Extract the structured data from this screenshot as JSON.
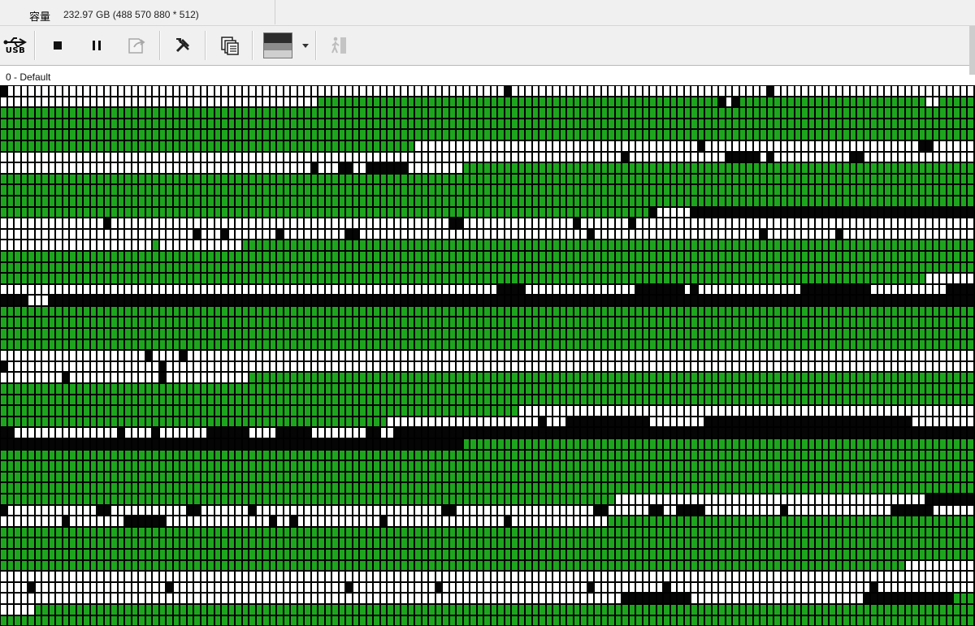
{
  "capacity": {
    "label": "容量",
    "value": "232.97 GB (488 570 880 * 512)"
  },
  "toolbar": {
    "usb_label": "USB",
    "buttons": [
      "usb-icon",
      "stop-icon",
      "pause-icon",
      "export-icon",
      "tools-icon",
      "copy-icon",
      "thumbnail-icon",
      "walk-icon"
    ]
  },
  "profile": {
    "label": "0 - Default"
  },
  "block_map": {
    "columns": 141,
    "legend_colors": {
      "good": "#1ea51e",
      "unread": "#ffffff",
      "bad": "#050505"
    },
    "rows": [
      "BWWWWWWWWWWWWWWWWWWWWWWWWWWWWWWWWWWWWWWWWWWWWWWWWWWWWWWWWWWWWWWWWWWWWWWWWBWWWWWWWWWWWWWWWWWWWWWWWWWWWWWWWWWWWWWBWWWWWWWWWWWWWWWWWWWWWWWWWWWWWW",
      "WWWWWWWWWWWWWWWWWWWWWWWWWWWWWWWWWWWWWWWWWWWWWWGGGGGGGGGGGGGGGGGGGGGGGGGGGGGGGGGGGGGGGGGGGGGGGGGGGGGGGGGGBWBGGGGGGGGGGGGGGGGGGGGGGGGGGGWWGGGGGGGGGGG",
      "GGGGGGGGGGGGGGGGGGGGGGGGGGGGGGGGGGGGGGGGGGGGGGGGGGGGGGGGGGGGGGGGGGGGGGGGGGGGGGGGGGGGGGGGGGGGGGGGGGGGGGGGGGGGGGGGGGGGGGGGGGGGGGGGGGGGGGGGGGGGGGGG",
      "GGGGGGGGGGGGGGGGGGGGGGGGGGGGGGGGGGGGGGGGGGGGGGGGGGGGGGGGGGGGGGGGGGGGGGGGGGGGGGGGGGGGGGGGGGGGGGGGGGGGGGGGGGGGGGGGGGGGGGGGGGGGGGGGGGGGGGGGGGGGGGG",
      "GGGGGGGGGGGGGGGGGGGGGGGGGGGGGGGGGGGGGGGGGGGGGGGGGGGGGGGGGGGGGGGGGGGGGGGGGGGGGGGGGGGGGGGGGGGGGGGGGGGGGGGGGGGGGGGGGGGGGGGGGGGGGGGGGGGGGGGGGGGGGGG",
      "GGGGGGGGGGGGGGGGGGGGGGGGGGGGGGGGGGGGGGGGGGGGGGGGGGGGGGGGGGGGWWWWWWWWWWWWWWWWWWWWWWWWWWWWWWWWWWWWWWWWWBWWWWWWWWWWWWWWWWWWWWWWWWWWWWWWWBBWWWWWWWWBW",
      "WWWWWWWWWWWWWWWWWWWWWWWWWWWWWWWWWWWWWWWWWWWWWWWWWWWWWWWWWWWWWWWWWWWWWWWWWWWWWWWWWWWWWWWWWWBWWWWWWWWWWWWWWBBBBBWBWWWWWWWWWWWBBWWWWWWWWWWWWWWWWWW",
      "WWWWWWWWWWWWWWWWWWWWWWWWWWWWWWWWWWWWWWWWWWWWWBWWWBBWWBBBBBBWWWWWWWWGGGGGGGGGGGGGGGGGGGGGGGGGGGGGGGGGGGGGGGGGGGGGGGGGGGGGGGGGGGGGGGGGGGGGGGGGGGGGG",
      "GGGGGGGGGGGGGGGGGGGGGGGGGGGGGGGGGGGGGGGGGGGGGGGGGGGGGGGGGGGGGGGGGGGGGGGGGGGGGGGGGGGGGGGGGGGGGGGGGGGGGGGGGGGGGGGGGGGGGGGGGGGGGGGGGGGGGGGGGGGGGGG",
      "GGGGGGGGGGGGGGGGGGGGGGGGGGGGGGGGGGGGGGGGGGGGGGGGGGGGGGGGGGGGGGGGGGGGGGGGGGGGGGGGGGGGGGGGGGGGGGGGGGGGGGGGGGGGGGGGGGGGGGGGGGGGGGGGGGGGGGGGGGGGGGG",
      "GGGGGGGGGGGGGGGGGGGGGGGGGGGGGGGGGGGGGGGGGGGGGGGGGGGGGGGGGGGGGGGGGGGGGGGGGGGGGGGGGGGGGGGGGGGGGGGGGGGGGGGGGGGGGGGGGGGGGGGGGGGGGGGGGGGGGGGGGGGGGGG",
      "GGGGGGGGGGGGGGGGGGGGGGGGGGGGGGGGGGGGGGGGGGGGGGGGGGGGGGGGGGGGGGGGGGGGGGGGGGGGGGGGGGGGGGGGGGGGGGBWWWWWBBBBBBBBBBBBBBBBBBBBBBBBBBBBBBBBBBBBBBBBBBBBB",
      "WWWWWWWWWWWWWWWBWWWWWWWWWWWWWWWWWWWWWWWWWWWWWWWWWWWWWWWWWWWWWWWWWBBWWWWWWWWWWWWWWWWBWWWWWWWBWWWWWWWWWWWWWWWWWWWWWWWWWWWWWWWWWWWWWWWWWWWWWWWWWWWWW",
      "WWWWWWWWWWWWWWWWWWWWWWWWWWWWBWWWBWWWWWWWBWWWWWWWWWBBWWWWWWWWWWWWWWWWWWWWWWWWWWWWWWWWWBWWWWWWWWWWWWWWWWWWWWWWWWBWWWWWWWWWWBWWWWWWWWWWWWWWWWWWWWWWWW",
      "WWWWWWWWWWWWWWWWWWWWWWGWWWWWWWWWWWWGGGGGGGGGGGGGGGGGGGGGGGGGGGGGGGGGGGGGGGGGGGGGGGGGGGGGGGGGGGGGGGGGGGGGGGGGGGGGGGGGGGGGGGGGGGGGGGGGGGGGGGGGGGGGG",
      "GGGGGGGGGGGGGGGGGGGGGGGGGGGGGGGGGGGGGGGGGGGGGGGGGGGGGGGGGGGGGGGGGGGGGGGGGGGGGGGGGGGGGGGGGGGGGGGGGGGGGGGGGGGGGGGGGGGGGGGGGGGGGGGGGGGGGGGGGGGGGGG",
      "GGGGGGGGGGGGGGGGGGGGGGGGGGGGGGGGGGGGGGGGGGGGGGGGGGGGGGGGGGGGGGGGGGGGGGGGGGGGGGGGGGGGGGGGGGGGGGGGGGGGGGGGGGGGGGGGGGGGGGGGGGGGGGGGGGGGGGGGGGGGGGG",
      "GGGGGGGGGGGGGGGGGGGGGGGGGGGGGGGGGGGGGGGGGGGGGGGGGGGGGGGGGGGGGGGGGGGGGGGGGGGGGGGGGGGGGGGGGGGGGGGGGGGGGGGGGGGGGGGGGGGGGGGGGGGGGGGGGGGGGGWWWWWWWWWWW",
      "WWWWWWWWWWWWWWWWWWWWWWWWWWWWWWWWWWWWWWWWWWWWWWWWWWWWWWWWWWWWWWWWWWWWWWWWBBBBWWWWWWWWWWWWWWWWBBBBBBBWBWWWWWWWWWWWWWWWBBBBBBBBBBWWWWWWWWWWWBBBBBBBBW",
      "BBBBWWWBBBBBBBBBBBBBBBBBBBBBBBBBBBBBBBBBBBBBBBBBBBBBBBBBBBBBBBBBBBBBBBBBBBBBBBBBBBBBBBBBBBBBBBBBBBBBBBBBBBBBBBBBBBBBBBBBBBBBBBBBBBBBBBBBBBBBBBBW",
      "GGGGGGGGGGGGGGGGGGGGGGGGGGGGGGGGGGGGGGGGGGGGGGGGGGGGGGGGGGGGGGGGGGGGGGGGGGGGGGGGGGGGGGGGGGGGGGGGGGGGGGGGGGGGGGGGGGGGGGGGGGGGGGGGGGGGGGGGGGGGGGG",
      "GGGGGGGGGGGGGGGGGGGGGGGGGGGGGGGGGGGGGGGGGGGGGGGGGGGGGGGGGGGGGGGGGGGGGGGGGGGGGGGGGGGGGGGGGGGGGGGGGGGGGGGGGGGGGGGGGGGGGGGGGGGGGGGGGGGGGGGGGGGGGGG",
      "GGGGGGGGGGGGGGGGGGGGGGGGGGGGGGGGGGGGGGGGGGGGGGGGGGGGGGGGGGGGGGGGGGGGGGGGGGGGGGGGGGGGGGGGGGGGGGGGGGGGGGGGGGGGGGGGGGGGGGGGGGGGGGGGGGGGGGGGGGGGGGG",
      "GGGGGGGGGGGGGGGGGGGGGGGGGGGGGGGGGGGGGGGGGGGGGGGGGGGGGGGGGGGGGGGGGGGGGGGGGGGGGGGGGGGGGGGGGGGGGGGGGGGGGGGGGGGGGGGGGGGGGGGGGGGGGGGGGGGGGGGGGGGGGGG",
      "WWWWWWWWWWWWWWWWWWWWWBWWWWBWWWWWWWWWWWWWWWWWWWWWWWWWWWWWWWWWWWWWWWWWWWWWWWWWWWWWWWWWWWWWWWWWWWWWWWWWWWWWWWWWWWWWWWWWWWWWWWWWWWWWWWWWWWWWWWWWWWWWW",
      "BWWWWWWWWWWWWWWWWWWWWWWBWWWWWWWWWWWWWWWWWWWWWWWWWWWWWWWWWWWWWWWWWWWWWWWWWWWWWWWWWWWWWWWWWWWWWWWWWWWWWWWWWWWWWWWWWWWWWWWWWWWWWWWWWWWWWWWWWWWWWWWWW",
      "WWWWWWWWWBWWWWWWWWWWWWWBWWWWWWWWWWWWGGGGGGGGGGGGGGGGGGGGGGGGGGGGGGGGGGGGGGGGGGGGGGGGGGGGGGGGGGGGGGGGGGGGGGGGGGGGGGGGGGGGGGGGGGGGGGGGGGGGGGGGGGGGGGG",
      "GGGGGGGGGGGGGGGGGGGGGGGGGGGGGGGGGGGGGGGGGGGGGGGGGGGGGGGGGGGGGGGGGGGGGGGGGGGGGGGGGGGGGGGGGGGGGGGGGGGGGGGGGGGGGGGGGGGGGGGGGGGGGGGGGGGGGGGGGGGGGG",
      "GGGGGGGGGGGGGGGGGGGGGGGGGGGGGGGGGGGGGGGGGGGGGGGGGGGGGGGGGGGGGGGGGGGGGGGGGGGGGGGGGGGGGGGGGGGGGGGGGGGGGGGGGGGGGGGGGGGGGGGGGGGGGGGGGGGGGGGGGGGGGGG",
      "GGGGGGGGGGGGGGGGGGGGGGGGGGGGGGGGGGGGGGGGGGGGGGGGGGGGGGGGGGGGGGGGGGGGGGGGGGGWWWWWWWWWWWWWWWWWWWWWWWWWWWWWWWWWWWWWWWWWWWWWWWWWWWWWWWWWWWWWWWWWWWW",
      "GGGGGGGGGGGGGGGGGGGGGGGGGGGGGGGGGGGGGGGGGGGGGGGGGGGGGGGGWWWWWWWWWWWWWWWWWWWWWWBWWWBBBBBBBBBBBBWWWWWWWWBBBBBBBBBBBBBBBBBBBBBBBBBBBBBBWWWWWWWWWWWWWW",
      "BBWWWWWWWWWWWWWWWBWWWWBWWWWWWWBBBBBBWWWWBBBBBWWWWWWWWBBWWBBBBBBBBBBBBBBBBBBBBBBBBBBBBBBBBBBBBBBBBBBBBBBBBBBBBBBBBBBBBBBBBBBBBBBBBBBBBBBBBBBBBBBBBB",
      "BBBBBBBBBBBBBBBBBBBBBBBBBBBBBBBBBBBBBBBBBBBBBBBBBBBBBBBBBBBBBBBBBBBGGGGGGGGGGGGGGGGGGGGGGGGGGGGGGGGGGGGGGGGGGGGGGGGGGGGGGGGGGGGGGGGGGGGGGGGGGGGGGG",
      "GGGGGGGGGGGGGGGGGGGGGGGGGGGGGGGGGGGGGGGGGGGGGGGGGGGGGGGGGGGGGGGGGGGGGGGGGGGGGGGGGGGGGGGGGGGGGGGGGGGGGGGGGGGGGGGGGGGGGGGGGGGGGGGGGGGGGGGGGGGGGGG",
      "GGGGGGGGGGGGGGGGGGGGGGGGGGGGGGGGGGGGGGGGGGGGGGGGGGGGGGGGGGGGGGGGGGGGGGGGGGGGGGGGGGGGGGGGGGGGGGGGGGGGGGGGGGGGGGGGGGGGGGGGGGGGGGGGGGGGGGGGGGGGGGG",
      "GGGGGGGGGGGGGGGGGGGGGGGGGGGGGGGGGGGGGGGGGGGGGGGGGGGGGGGGGGGGGGGGGGGGGGGGGGGGGGGGGGGGGGGGGGGGGGGGGGGGGGGGGGGGGGGGGGGGGGGGGGGGGGGGGGGGGGGGGGGGGGG",
      "GGGGGGGGGGGGGGGGGGGGGGGGGGGGGGGGGGGGGGGGGGGGGGGGGGGGGGGGGGGGGGGGGGGGGGGGGGGGGGGGGGGGGGGGGGGGGGGGGGGGGGGGGGGGGGGGGGGGGGGGGGGGGGGGGGGGGGGGGGGGGGG",
      "GGGGGGGGGGGGGGGGGGGGGGGGGGGGGGGGGGGGGGGGGGGGGGGGGGGGGGGGGGGGGGGGGGGGGGGGGGGGGGGGGGGGGGGGGWWWWWWWWWWWWWWWWWWWWWWWWWWWWWWWWWWWWWWWWWWWWWBBBBBBBWWWW",
      "BWWWWWWWWWWWWWBBWWWWWWWWWWWBBWWWWWWWBWWWWWWWWWWWWWWWWWWWWWWWWWWWBBWWWWWWWWWWWWWWWWWWWWBBWWWWWWBBWWBBBBWWWWWWWWWWWBWWWWWWWWWWWWWWWBBBBBBWWWWWWWWWWW",
      "WWWWWWWWWBWWWWWWWWBBBBBBWWWWWWWWWWWWWWWBWWBWWWWWWWWWWWWBWWWWWWWWWWWWWWWWWBWWWWWWWWWWWWWWGGGGGGGGGGGGGGGGGGGGGGGGGGGGGGGGGGGGGGGGGGGGGGGGGGGGGGGGGG",
      "GGGGGGGGGGGGGGGGGGGGGGGGGGGGGGGGGGGGGGGGGGGGGGGGGGGGGGGGGGGGGGGGGGGGGGGGGGGGGGGGGGGGGGGGGGGGGGGGGGGGGGGGGGGGGGGGGGGGGGGGGGGGGGGGGGGGGGGGGGGGGGGG",
      "GGGGGGGGGGGGGGGGGGGGGGGGGGGGGGGGGGGGGGGGGGGGGGGGGGGGGGGGGGGGGGGGGGGGGGGGGGGGGGGGGGGGGGGGGGGGGGGGGGGGGGGGGGGGGGGGGGGGGGGGGGGGGGGGGGGGGGGGGGGGGGG",
      "GGGGGGGGGGGGGGGGGGGGGGGGGGGGGGGGGGGGGGGGGGGGGGGGGGGGGGGGGGGGGGGGGGGGGGGGGGGGGGGGGGGGGGGGGGGGGGGGGGGGGGGGGGGGGGGGGGGGGGGGGGGGGGGGGGGGGGGGGGGGGGG",
      "GGGGGGGGGGGGGGGGGGGGGGGGGGGGGGGGGGGGGGGGGGGGGGGGGGGGGGGGGGGGGGGGGGGGGGGGGGGGGGGGGGGGGGGGGGGGGGGGGGGGGGGGGGGGGGGGGGGGGGGGGGGGGGGGGGGWWWWWWWWWWWWW",
      "WWWWWWWWWWWWWWWWWWWWWWWWWWWWWWWWWWWWWWWWWWWWWWWWWWWWWWWWWWWWWWWWWWWWWWWWWWWWWWWWWWWWWWWWWWWWWWWWWWWWWWWWWWWWWWWWWWWWWWWWWWWWWWWWWWWWWWWWWWWWWW",
      "WWWWBWWWWWWWWWWWWWWWWWWWBWWWWWWWWWWWWWWWWWWWWWWWWWBWWWWWWWWWWWWBWWWWWWWWWWWWWWWWWWWWWBWWWWWWWWWWBWWWWWWWWWWWWWWWWWWWWWWWWWWWWWBWWWWWWWWWWWWWWWBWW",
      "WWWWWWWWWWWWWWWWWWWWWWWWWWWWWWWWWWWWWWWWWWWWWWWWWWWWWWWWWWWWWWWWWWWWWWWWWWWWWWWWWWWWWWWWWWBBBBBBBBBBWWWWWWWWWWWWWWWWWWWWWWWWWBBBBBBBBBBBBBGGGGGGGG",
      "WWWWWGGGGGGGGGGGGGGGGGGGGGGGGGGGGGGGGGGGGGGGGGGGGGGGGGGGGGGGGGGGGGGGGGGGGGGGGGGGGGGGGGGGGGGGGGGGGGGGGGGGGGGGGGGGGGGGGGGGGGGGGGGGGGGGGGGGGGGGGGG",
      "GGGGGGGGGGGGGGGGGGGGGGGGGGGGGGGGGGGGGGGGGGGGGGGGGGGGGGGGGGGGGGGGGGGGGGGGGGGGGGGGGGGGGGGGGGGGGGGGGGGGGGGGGGGGGGGGGGGGGGGGGGGGGGGGGGGGGGGGGGGGGG"
    ]
  }
}
